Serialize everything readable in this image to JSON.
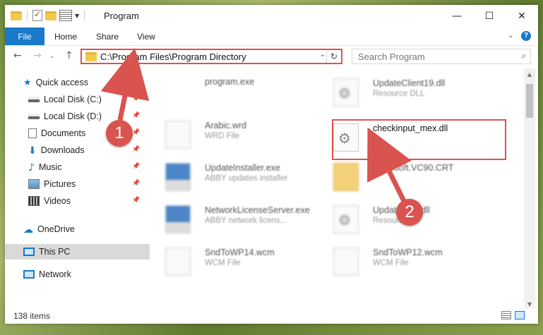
{
  "window": {
    "title": "Program",
    "minimize": "—",
    "maximize": "☐",
    "close": "✕"
  },
  "ribbon": {
    "tabs": [
      "File",
      "Home",
      "Share",
      "View"
    ],
    "help": "?"
  },
  "address": {
    "path": "C:\\Program Files\\Program Directory"
  },
  "search": {
    "placeholder": "Search Program"
  },
  "nav": {
    "items": [
      {
        "label": "Quick access",
        "icon": "star-icon"
      },
      {
        "label": "Local Disk (C:)",
        "icon": "drive-icon"
      },
      {
        "label": "Local Disk (D:)",
        "icon": "drive-icon"
      },
      {
        "label": "Documents",
        "icon": "documents-icon"
      },
      {
        "label": "Downloads",
        "icon": "download-icon"
      },
      {
        "label": "Music",
        "icon": "music-icon"
      },
      {
        "label": "Pictures",
        "icon": "pictures-icon"
      },
      {
        "label": "Videos",
        "icon": "videos-icon"
      },
      {
        "label": "OneDrive",
        "icon": "cloud-icon"
      },
      {
        "label": "This PC",
        "icon": "computer-icon"
      },
      {
        "label": "Network",
        "icon": "network-icon"
      }
    ]
  },
  "files": [
    {
      "name": "program.exe",
      "sub": ""
    },
    {
      "name": "UpdateClient19.dll",
      "sub": "Resource DLL"
    },
    {
      "name": "Arabic.wrd",
      "sub": "WRD File"
    },
    {
      "name": "checkinput_mex.dll",
      "sub": ""
    },
    {
      "name": "UpdateInstaller.exe",
      "sub": "ABBY updates installer"
    },
    {
      "name": "Microsoft.VC90.CRT",
      "sub": ""
    },
    {
      "name": "NetworkLicenseServer.exe",
      "sub": "ABBY network licens..."
    },
    {
      "name": "Update...63.dll",
      "sub": "Resource..."
    },
    {
      "name": "SndToWP14.wcm",
      "sub": "WCM File"
    },
    {
      "name": "SndToWP12.wcm",
      "sub": "WCM File"
    }
  ],
  "status": {
    "count": "138 items"
  },
  "callouts": {
    "one": "1",
    "two": "2"
  },
  "colors": {
    "accent": "#1979ca",
    "highlight": "#d9534f"
  }
}
